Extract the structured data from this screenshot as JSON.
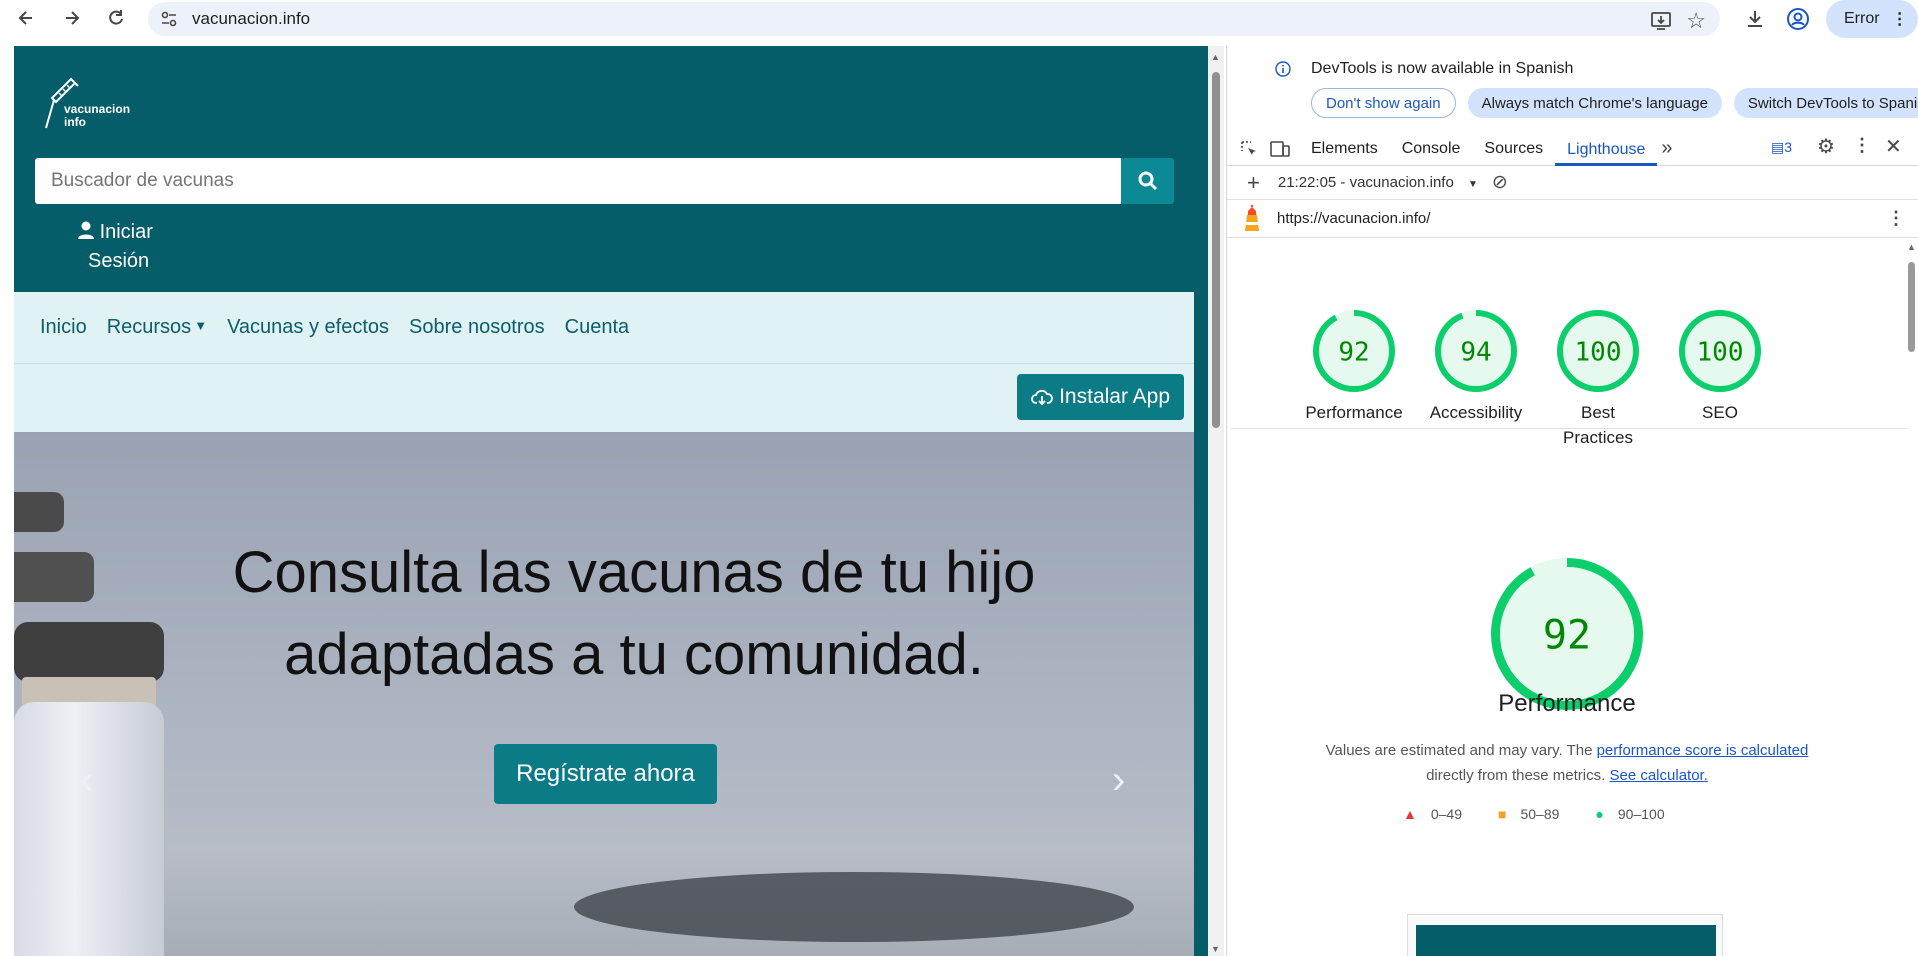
{
  "browser": {
    "url": "vacunacion.info",
    "profile_label": "Error"
  },
  "site": {
    "logo_line1": "vacunacion",
    "logo_line2": "info",
    "search_placeholder": "Buscador de vacunas",
    "login_line1": "Iniciar",
    "login_line2": "Sesión",
    "nav": [
      "Inicio",
      "Recursos",
      "Vacunas y efectos",
      "Sobre nosotros",
      "Cuenta"
    ],
    "install_label": "Instalar App",
    "hero_title_line1": "Consulta las vacunas de tu hijo",
    "hero_title_line2": "adaptadas a tu comunidad.",
    "hero_button": "Regístrate ahora",
    "brand_color": "#055d69"
  },
  "devtools": {
    "info_message": "DevTools is now available in Spanish",
    "info_buttons": [
      "Don't show again",
      "Always match Chrome's language",
      "Switch DevTools to Spanish"
    ],
    "tabs": [
      "Elements",
      "Console",
      "Sources",
      "Lighthouse"
    ],
    "active_tab": "Lighthouse",
    "issues_count": "3",
    "report_select": "21:22:05 - vacunacion.info",
    "report_url": "https://vacunacion.info/",
    "scores": [
      {
        "label": "Performance",
        "value": 92
      },
      {
        "label": "Accessibility",
        "value": 94
      },
      {
        "label": "Best Practices",
        "value": 100
      },
      {
        "label": "SEO",
        "value": 100
      }
    ],
    "main_score": 92,
    "main_label": "Performance",
    "note_text1": "Values are estimated and may vary. The ",
    "note_link1": "performance score is calculated",
    "note_text2": "directly from these metrics.",
    "note_link2": "See calculator.",
    "legend": [
      {
        "label": "0–49",
        "color": "#e53935"
      },
      {
        "label": "50–89",
        "color": "#fb9d2a"
      },
      {
        "label": "90–100",
        "color": "#0cce6b"
      }
    ],
    "score_color": "#0cce6b",
    "score_text_color": "#008800"
  }
}
